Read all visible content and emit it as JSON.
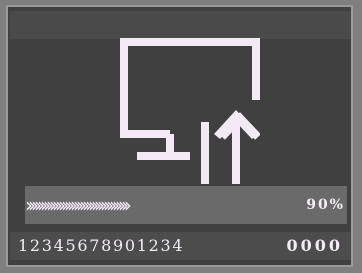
{
  "colors": {
    "outer_frame": "#7f7f7f",
    "screen_bg": "#404040",
    "glyph": "#f3eaf6"
  },
  "device": {
    "icon": "monitor-upload-icon",
    "progress": {
      "value": 0.9,
      "chevrons": "››››››››››››››››››››››››››››››››››",
      "percent_label": "90%"
    },
    "footer": {
      "serial": "12345678901234",
      "counter": "0000"
    }
  }
}
